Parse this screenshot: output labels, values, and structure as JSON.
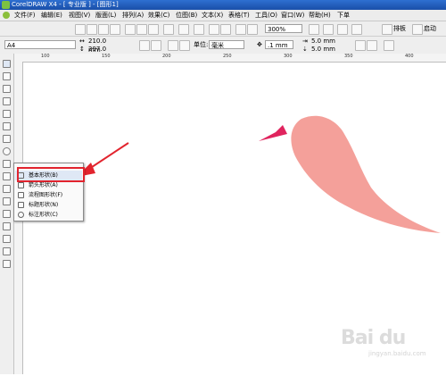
{
  "title_bar": {
    "text": "CorelDRAW X4 - [ 专业版 ] - [图形1]"
  },
  "menu": {
    "items": [
      "文件(F)",
      "编辑(E)",
      "视图(V)",
      "版面(L)",
      "排列(A)",
      "效果(C)",
      "位图(B)",
      "文本(X)",
      "表格(T)",
      "工具(O)",
      "窗口(W)",
      "帮助(H)",
      "下单"
    ]
  },
  "toolbar": {
    "zoom": "300%",
    "right_label_1": "排板",
    "right_label_2": "启动"
  },
  "property_bar": {
    "page_size": "A4",
    "width": "210.0 mm",
    "height": "297.0 mm",
    "units_label": "单位:",
    "units_value": "毫米",
    "nudge": ".1 mm",
    "dup_x": "5.0 mm",
    "dup_y": "5.0 mm"
  },
  "ruler": {
    "h_labels": [
      "100",
      "150",
      "200",
      "250",
      "300",
      "350",
      "400"
    ]
  },
  "flyout": {
    "items": [
      {
        "label": "基本形状(B)",
        "icon": "basic-shape-icon"
      },
      {
        "label": "箭头形状(A)",
        "icon": "arrow-shape-icon"
      },
      {
        "label": "流程图形状(F)",
        "icon": "flowchart-icon"
      },
      {
        "label": "标题形状(N)",
        "icon": "banner-icon"
      },
      {
        "label": "标注形状(C)",
        "icon": "callout-icon"
      }
    ],
    "highlighted": 0
  },
  "drawing": {
    "shape_color": "#f4a09a",
    "spike_color": "#e0245e",
    "arrow_color": "#e2242e"
  },
  "watermark": {
    "logo": "Bai du",
    "subtitle": "jingyan.baidu.com"
  }
}
